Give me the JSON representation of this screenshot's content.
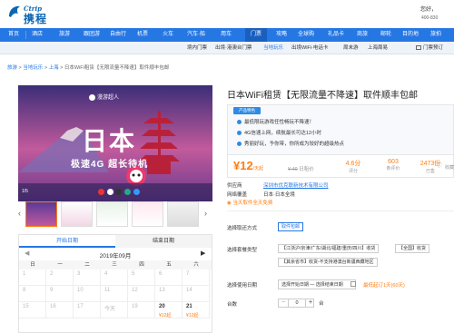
{
  "header": {
    "logo_en": "Ctrip",
    "logo_cn": "携程",
    "greeting": "您好，",
    "phone": "400-830"
  },
  "nav": [
    {
      "label": "首页",
      "active": false
    },
    {
      "label": "酒店",
      "active": false
    },
    {
      "label": "旅游",
      "active": false
    },
    {
      "label": "跟团游",
      "active": false
    },
    {
      "label": "自由行",
      "active": false
    },
    {
      "label": "机票",
      "active": false
    },
    {
      "label": "火车",
      "active": false
    },
    {
      "label": "汽车·船",
      "active": false
    },
    {
      "label": "用车",
      "active": false
    },
    {
      "label": "门票",
      "active": true
    },
    {
      "label": "攻略",
      "active": false
    },
    {
      "label": "全球购",
      "active": false
    },
    {
      "label": "礼品卡",
      "active": false
    },
    {
      "label": "商旅",
      "active": false
    },
    {
      "label": "邮轮",
      "active": false
    },
    {
      "label": "目的地",
      "active": false
    },
    {
      "label": "旅拍",
      "active": false
    }
  ],
  "subnav": {
    "items": [
      "境内门票",
      "出境·港澳台门票",
      "当地玩乐",
      "出境WiFi·电话卡",
      "周末游",
      "上海周易"
    ],
    "active_index": 2,
    "right": "门票预订"
  },
  "breadcrumb": {
    "items": [
      "旅游",
      "当地玩乐",
      "上海"
    ],
    "current": "日本WiFi租赁【无限流量不降速】取件顺丰包邮"
  },
  "gallery": {
    "brand": "漫游超人",
    "headline": "日本",
    "subline": "极速4G 超长待机",
    "index": "1/5"
  },
  "calendar": {
    "tab_start": "开始日期",
    "tab_end": "结束日期",
    "month": "2019年09月",
    "weekdays": [
      "日",
      "一",
      "二",
      "三",
      "四",
      "五",
      "六"
    ],
    "row1": [
      "1",
      "2",
      "3",
      "4",
      "5",
      "6",
      "7"
    ],
    "row2": [
      "8",
      "9",
      "10",
      "11",
      "12",
      "13",
      "14"
    ],
    "row3": [
      "15",
      "16",
      "17",
      "今天",
      "19",
      "20",
      "21"
    ],
    "price_20": "¥12起",
    "price_21": "¥12起"
  },
  "product": {
    "title": "日本WiFi租赁【无限流量不降速】取件顺丰包邮",
    "feature_tag": "产品特色",
    "features": [
      "最低限玩游戏任性畅玩不降速！",
      "4G信速上网，续航最长可达12小时",
      "秀丽好玩，予你带，你所成为较好的超级热点"
    ],
    "price_symbol": "¥",
    "price": "12",
    "price_unit": "/天起",
    "orig_price": "¥ 40",
    "orig_label": "日租价",
    "stats": [
      {
        "value": "4.6分",
        "label": "评分"
      },
      {
        "value": "603",
        "label": "条评价"
      },
      {
        "value": "2473份",
        "label": "已售"
      }
    ],
    "fav_label": "收藏",
    "supplier_label": "供应商",
    "supplier": "深圳市优克联新技术有限公司",
    "area_label": "网络覆盖",
    "area": "日本·日本全境",
    "badge": "当天取件全天免费",
    "pickup_label": "选择取还方式",
    "pickup_option": "取件包邮",
    "package_label": "选择套餐类型",
    "packages": [
      "【江浙沪/京津/广东/湖北/福建/重庆/四川】收货",
      "【全国】收货",
      "【其余省市】收货-不支持港澳台新疆西藏地区"
    ],
    "date_label": "选择使用日期",
    "date_placeholder": "选择开始日期 — 选择结束日期",
    "date_hint": "最低起订1天(60天)",
    "qty_label": "台数",
    "qty": "0",
    "qty_unit": "台"
  },
  "colors": {
    "nav_blue": "#2577e3",
    "accent_orange": "#ff7d13"
  }
}
